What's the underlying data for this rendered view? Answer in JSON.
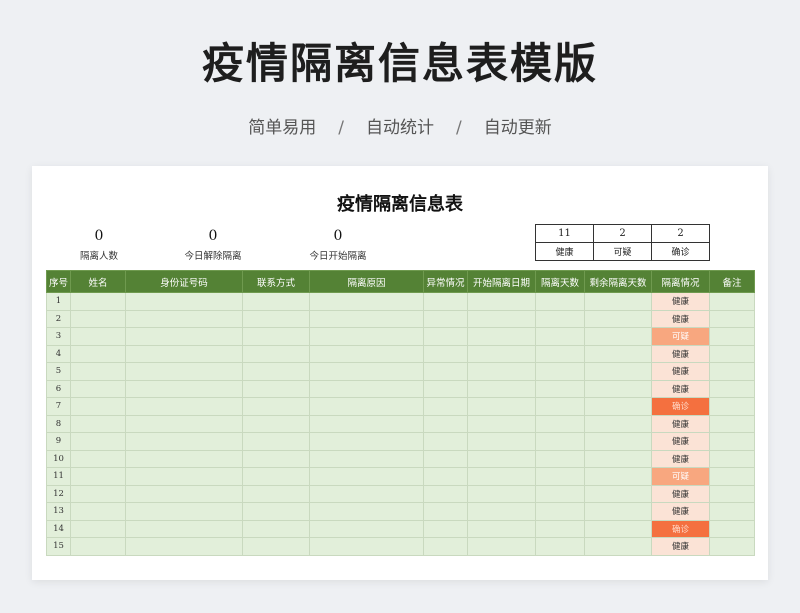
{
  "page": {
    "title": "疫情隔离信息表模版",
    "tags": [
      "简单易用",
      "自动统计",
      "自动更新"
    ],
    "separator": "/"
  },
  "sheet": {
    "title": "疫情隔离信息表",
    "stats": [
      {
        "value": "0",
        "label": "隔离人数"
      },
      {
        "value": "0",
        "label": "今日解除隔离"
      },
      {
        "value": "0",
        "label": "今日开始隔离"
      }
    ],
    "summary": [
      {
        "value": "11",
        "label": "健康"
      },
      {
        "value": "2",
        "label": "可疑"
      },
      {
        "value": "2",
        "label": "确诊"
      }
    ],
    "columns": [
      "序号",
      "姓名",
      "身份证号码",
      "联系方式",
      "隔离原因",
      "异常情况",
      "开始隔离日期",
      "隔离天数",
      "剩余隔离天数",
      "隔离情况",
      "备注"
    ],
    "rows": [
      {
        "no": "1",
        "status": "健康"
      },
      {
        "no": "2",
        "status": "健康"
      },
      {
        "no": "3",
        "status": "可疑"
      },
      {
        "no": "4",
        "status": "健康"
      },
      {
        "no": "5",
        "status": "健康"
      },
      {
        "no": "6",
        "status": "健康"
      },
      {
        "no": "7",
        "status": "确诊"
      },
      {
        "no": "8",
        "status": "健康"
      },
      {
        "no": "9",
        "status": "健康"
      },
      {
        "no": "10",
        "status": "健康"
      },
      {
        "no": "11",
        "status": "可疑"
      },
      {
        "no": "12",
        "status": "健康"
      },
      {
        "no": "13",
        "status": "健康"
      },
      {
        "no": "14",
        "status": "确诊"
      },
      {
        "no": "15",
        "status": "健康"
      }
    ],
    "colors": {
      "header": "#548235",
      "cell": "#e2efda",
      "healthy": "#fbe3d6",
      "suspect": "#f8a77f",
      "confirmed": "#f4703f"
    }
  }
}
